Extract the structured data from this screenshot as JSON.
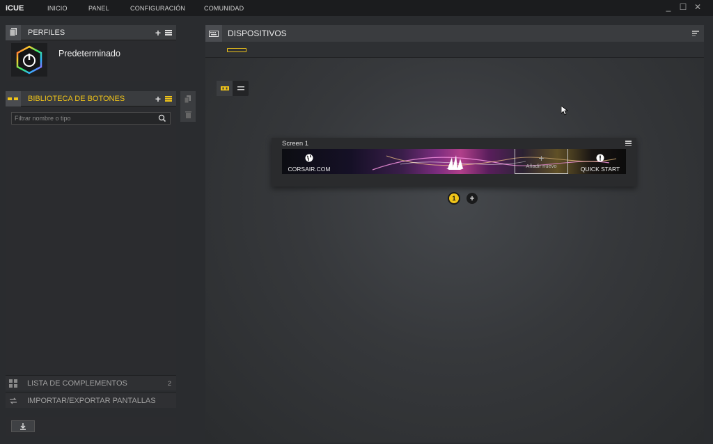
{
  "app": {
    "brand": "iCUE"
  },
  "nav": [
    {
      "label": "INICIO"
    },
    {
      "label": "PANEL"
    },
    {
      "label": "CONFIGURACIÓN"
    },
    {
      "label": "COMUNIDAD"
    }
  ],
  "window": {
    "minimize": "_",
    "maximize": "☐",
    "close": "✕"
  },
  "profiles": {
    "title": "PERFILES",
    "items": [
      {
        "name": "Predeterminado"
      }
    ]
  },
  "library": {
    "title": "BIBLIOTECA DE BOTONES",
    "search_placeholder": "Filtrar nombre o tipo"
  },
  "footer": {
    "plugins_label": "LISTA DE COMPLEMENTOS",
    "plugins_count": "2",
    "import_export_label": "IMPORTAR/EXPORTAR PANTALLAS"
  },
  "devices": {
    "title": "DISPOSITIVOS"
  },
  "screen": {
    "name": "Screen 1",
    "tiles": [
      {
        "label": "CORSAIR.COM",
        "icon": "globe-icon"
      },
      {
        "label": "",
        "icon": "corsair-sails-logo"
      },
      {
        "label": "Añadir nuevo",
        "icon": "plus-icon"
      },
      {
        "label": "QUICK START",
        "icon": "alert-icon"
      }
    ]
  },
  "pager": {
    "current": "1"
  },
  "colors": {
    "accent": "#f0c419",
    "panel": "#3a3c3f",
    "background": "#2a2c2f"
  }
}
